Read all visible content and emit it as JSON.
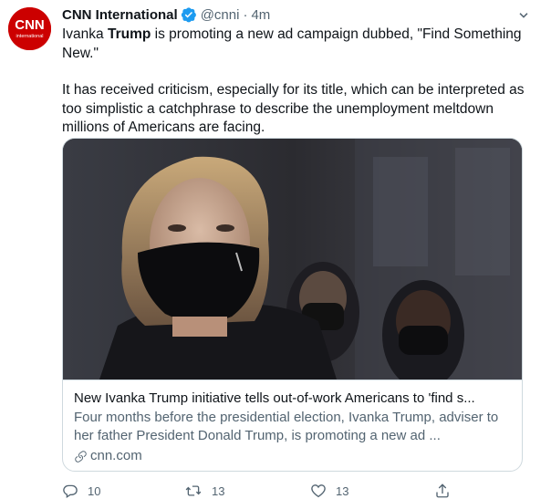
{
  "account": {
    "name": "CNN International",
    "handle": "@cnni",
    "separator": "·",
    "time": "4m",
    "avatar_text_top": "CNN",
    "avatar_text_bottom": "international"
  },
  "tweet": {
    "p1_before": "Ivanka ",
    "p1_bold": "Trump",
    "p1_after": " is promoting a new ad campaign dubbed, \"Find Something New.\"",
    "p2": "It has received criticism, especially for its title, which can be interpreted as too simplistic a catchphrase to describe the unemployment meltdown millions of Americans are facing."
  },
  "card": {
    "title": "New Ivanka Trump initiative tells out-of-work Americans to 'find s...",
    "description": "Four months before the presidential election, Ivanka Trump, adviser to her father President Donald Trump, is promoting a new ad ...",
    "domain": "cnn.com"
  },
  "actions": {
    "replies": "10",
    "retweets": "13",
    "likes": "13"
  },
  "icons": {
    "verified": "verified-badge-icon",
    "caret": "chevron-down-icon",
    "link": "link-icon",
    "reply": "reply-icon",
    "retweet": "retweet-icon",
    "like": "heart-icon",
    "share": "share-icon"
  },
  "colors": {
    "brand_red": "#cc0000",
    "verified_blue": "#1d9bf0",
    "secondary_text": "#536471"
  }
}
